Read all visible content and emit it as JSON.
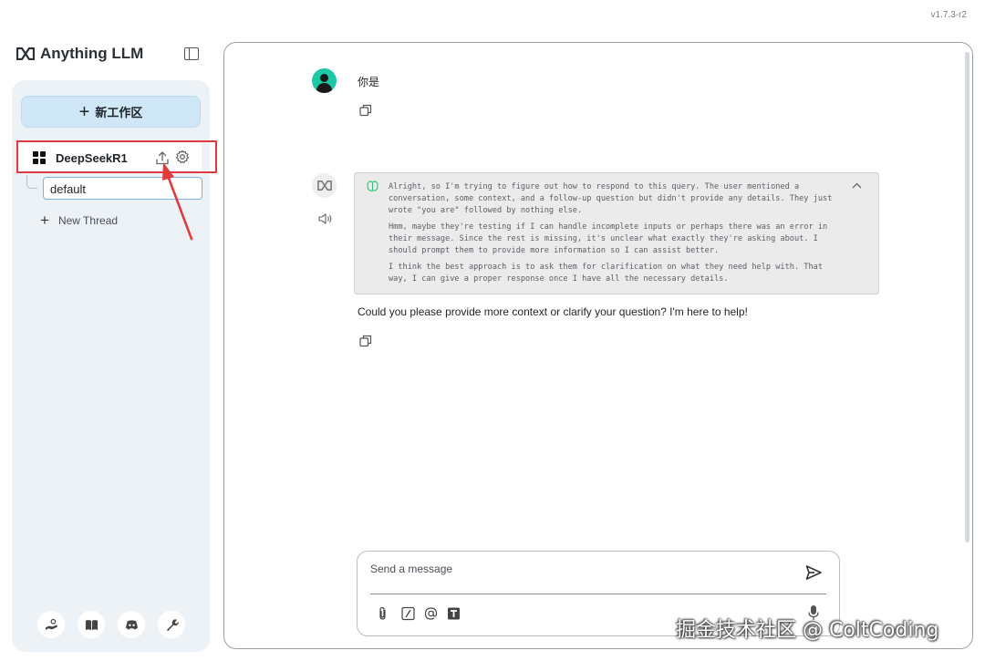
{
  "app": {
    "version": "v1.7.3-r2",
    "logo_text": "Anything LLM"
  },
  "sidebar": {
    "new_workspace_label": "新工作区",
    "workspaces": [
      {
        "name": "DeepSeekR1",
        "threads": [
          {
            "label": "default"
          }
        ],
        "new_thread_label": "New Thread"
      }
    ],
    "footer_icons": [
      "community-hub-icon",
      "docs-book-icon",
      "discord-icon",
      "settings-wrench-icon"
    ]
  },
  "chat": {
    "messages": [
      {
        "role": "user",
        "text": "你是"
      },
      {
        "role": "assistant",
        "thinking": [
          "Alright, so I'm trying to figure out how to respond to this query. The user mentioned a conversation, some context, and a follow-up question but didn't provide any details. They just wrote \"you are\" followed by nothing else.",
          "Hmm, maybe they're testing if I can handle incomplete inputs or perhaps there was an error in their message. Since the rest is missing, it's unclear what exactly they're asking about. I should prompt them to provide more information so I can assist better.",
          "I think the best approach is to ask them for clarification on what they need help with. That way, I can give a proper response once I have all the necessary details."
        ],
        "text": "Could you please provide more context or clarify your question? I'm here to help!"
      }
    ],
    "composer": {
      "placeholder": "Send a message",
      "value": ""
    }
  },
  "watermark": "掘金技术社区 @ ColtCoding",
  "colors": {
    "accent_button": "#cfe7f7",
    "annotation_red": "#e23b3b",
    "avatar_user": "#1cc8a6"
  }
}
